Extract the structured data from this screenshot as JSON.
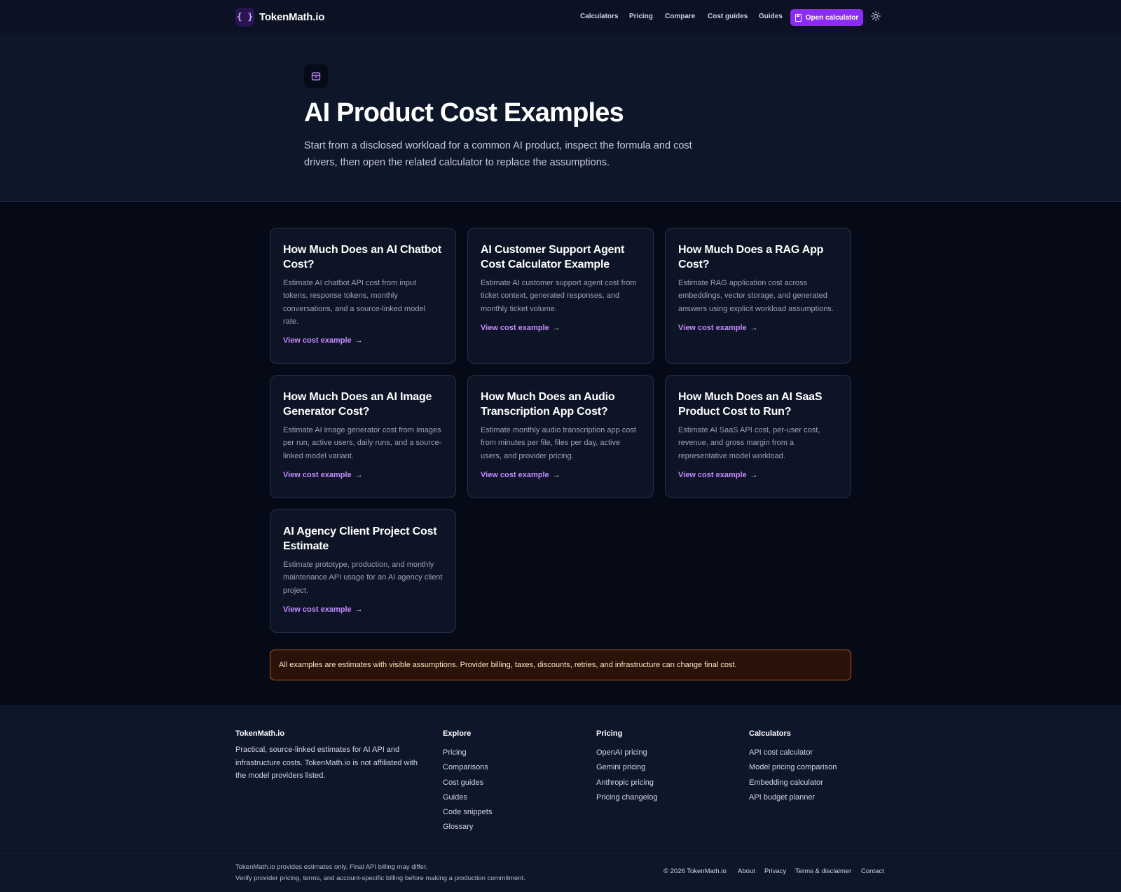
{
  "header": {
    "logo_glyph": "{ }",
    "brand": "TokenMath.io",
    "nav": [
      "Calculators",
      "Pricing",
      "Compare",
      "Cost guides",
      "Guides"
    ],
    "open_calculator": "Open calculator",
    "theme_icon": "sun-icon"
  },
  "hero": {
    "icon": "archive-icon",
    "title": "AI Product Cost Examples",
    "subtitle": "Start from a disclosed workload for a common AI product, inspect the formula and cost drivers, then open the related calculator to replace the assumptions."
  },
  "cards": [
    {
      "title": "How Much Does an AI Chatbot Cost?",
      "desc": "Estimate AI chatbot API cost from input tokens, response tokens, monthly conversations, and a source-linked model rate.",
      "link": "View cost example"
    },
    {
      "title": "AI Customer Support Agent Cost Calculator Example",
      "desc": "Estimate AI customer support agent cost from ticket context, generated responses, and monthly ticket volume.",
      "link": "View cost example"
    },
    {
      "title": "How Much Does a RAG App Cost?",
      "desc": "Estimate RAG application cost across embeddings, vector storage, and generated answers using explicit workload assumptions.",
      "link": "View cost example"
    },
    {
      "title": "How Much Does an AI Image Generator Cost?",
      "desc": "Estimate AI image generator cost from images per run, active users, daily runs, and a source-linked model variant.",
      "link": "View cost example"
    },
    {
      "title": "How Much Does an Audio Transcription App Cost?",
      "desc": "Estimate monthly audio transcription app cost from minutes per file, files per day, active users, and provider pricing.",
      "link": "View cost example"
    },
    {
      "title": "How Much Does an AI SaaS Product Cost to Run?",
      "desc": "Estimate AI SaaS API cost, per-user cost, revenue, and gross margin from a representative model workload.",
      "link": "View cost example"
    },
    {
      "title": "AI Agency Client Project Cost Estimate",
      "desc": "Estimate prototype, production, and monthly maintenance API usage for an AI agency client project.",
      "link": "View cost example"
    }
  ],
  "arrow_glyph": "→",
  "notice": "All examples are estimates with visible assumptions. Provider billing, taxes, discounts, retries, and infrastructure can change final cost.",
  "footer": {
    "brand": "TokenMath.io",
    "about": "Practical, source-linked estimates for AI API and infrastructure costs. TokenMath.io is not affiliated with the model providers listed.",
    "columns": [
      {
        "heading": "Explore",
        "links": [
          "Pricing",
          "Comparisons",
          "Cost guides",
          "Guides",
          "Code snippets",
          "Glossary"
        ]
      },
      {
        "heading": "Pricing",
        "links": [
          "OpenAI pricing",
          "Gemini pricing",
          "Anthropic pricing",
          "Pricing changelog"
        ]
      },
      {
        "heading": "Calculators",
        "links": [
          "API cost calculator",
          "Model pricing comparison",
          "Embedding calculator",
          "API budget planner"
        ]
      }
    ],
    "disclaimer_1": "TokenMath.io provides estimates only. Final API billing may differ.",
    "disclaimer_2": "Verify provider pricing, terms, and account-specific billing before making a production commitment.",
    "copyright": "© 2026 TokenMath.io",
    "bottom_links": [
      "About",
      "Privacy",
      "Terms & disclaimer",
      "Contact"
    ]
  },
  "colors": {
    "accent": "#8b2cf5",
    "link": "#c58bff",
    "notice_border": "#b3531f"
  }
}
